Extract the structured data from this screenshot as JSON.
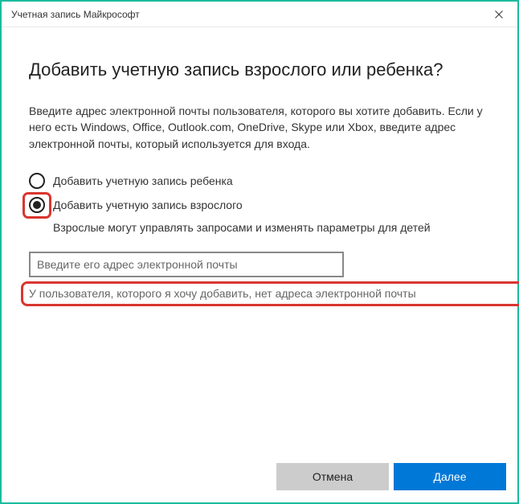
{
  "titlebar": {
    "title": "Учетная запись Майкрософт"
  },
  "main": {
    "heading": "Добавить учетную запись взрослого или ребенка?",
    "description": "Введите адрес электронной почты пользователя, которого вы хотите добавить. Если у него есть Windows, Office, Outlook.com, OneDrive, Skype или Xbox, введите адрес электронной почты, который используется для входа.",
    "radio_child_label": "Добавить учетную запись ребенка",
    "radio_adult_label": "Добавить учетную запись взрослого",
    "radio_selected": "adult",
    "note_text": "Взрослые могут управлять запросами и изменять параметры для детей",
    "email_placeholder": "Введите его адрес электронной почты",
    "email_value": "",
    "no_email_label": "У пользователя, которого я хочу добавить, нет адреса электронной почты"
  },
  "footer": {
    "cancel_label": "Отмена",
    "next_label": "Далее"
  }
}
